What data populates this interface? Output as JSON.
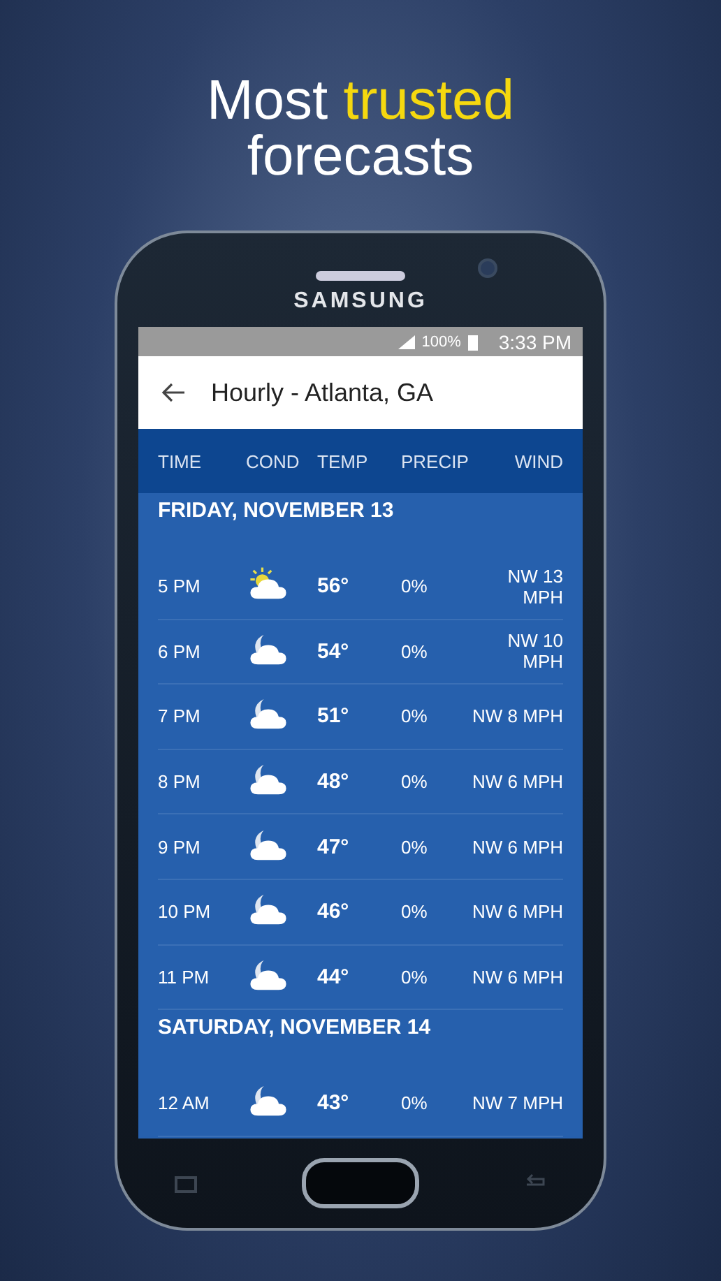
{
  "headline": [
    {
      "text": "Most",
      "highlight": false
    },
    {
      "text": "trusted",
      "highlight": true
    },
    {
      "text": "forecasts",
      "highlight": false
    }
  ],
  "phone": {
    "brand": "SAMSUNG"
  },
  "status_bar": {
    "battery": "100%",
    "time": "3:33 PM"
  },
  "app_bar": {
    "title": "Hourly - Atlanta, GA"
  },
  "columns": [
    "TIME",
    "COND",
    "TEMP",
    "PRECIP",
    "WIND"
  ],
  "days": [
    {
      "label": "FRIDAY, NOVEMBER 13",
      "hours": [
        {
          "time": "5 PM",
          "kind": "partly-sunny",
          "temp": "56°",
          "precip": "0%",
          "wind": "NW 13 MPH"
        },
        {
          "time": "6 PM",
          "kind": "night-cloudy",
          "temp": "54°",
          "precip": "0%",
          "wind": "NW 10 MPH"
        },
        {
          "time": "7 PM",
          "kind": "night-cloudy",
          "temp": "51°",
          "precip": "0%",
          "wind": "NW 8 MPH"
        },
        {
          "time": "8 PM",
          "kind": "night-cloudy",
          "temp": "48°",
          "precip": "0%",
          "wind": "NW 6 MPH"
        },
        {
          "time": "9 PM",
          "kind": "night-cloudy",
          "temp": "47°",
          "precip": "0%",
          "wind": "NW 6 MPH"
        },
        {
          "time": "10 PM",
          "kind": "night-cloudy",
          "temp": "46°",
          "precip": "0%",
          "wind": "NW 6 MPH"
        },
        {
          "time": "11 PM",
          "kind": "night-cloudy",
          "temp": "44°",
          "precip": "0%",
          "wind": "NW 6 MPH"
        }
      ]
    },
    {
      "label": "SATURDAY, NOVEMBER 14",
      "hours": [
        {
          "time": "12 AM",
          "kind": "night-cloudy",
          "temp": "43°",
          "precip": "0%",
          "wind": "NW 7 MPH"
        }
      ]
    }
  ]
}
